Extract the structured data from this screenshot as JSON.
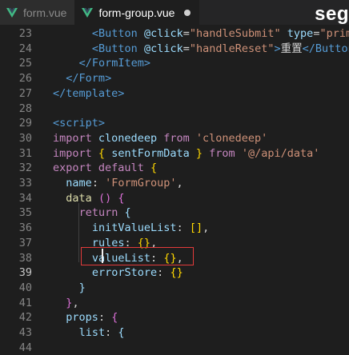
{
  "tabs": [
    {
      "label": "form.vue",
      "active": false,
      "modified": false
    },
    {
      "label": "form-group.vue",
      "active": true,
      "modified": true
    }
  ],
  "watermark": "seg",
  "editor": {
    "current_line": "39",
    "lines": [
      {
        "n": "23",
        "indent": 6,
        "tokens": [
          [
            "t-tag",
            "<Button"
          ],
          [
            "t-txt",
            " "
          ],
          [
            "t-attr",
            "@click"
          ],
          [
            "t-txt",
            "="
          ],
          [
            "t-str",
            "\"handleSubmit\""
          ],
          [
            "t-txt",
            " "
          ],
          [
            "t-attr",
            "type"
          ],
          [
            "t-txt",
            "="
          ],
          [
            "t-str",
            "\"primar"
          ]
        ]
      },
      {
        "n": "24",
        "indent": 6,
        "tokens": [
          [
            "t-tag",
            "<Button"
          ],
          [
            "t-txt",
            " "
          ],
          [
            "t-attr",
            "@click"
          ],
          [
            "t-txt",
            "="
          ],
          [
            "t-str",
            "\"handleReset\""
          ],
          [
            "t-tag",
            ">"
          ],
          [
            "t-txt",
            "重置"
          ],
          [
            "t-tag",
            "</Button"
          ],
          [
            "t-tag",
            ">"
          ]
        ]
      },
      {
        "n": "25",
        "indent": 4,
        "tokens": [
          [
            "t-tag",
            "</FormItem>"
          ]
        ]
      },
      {
        "n": "26",
        "indent": 2,
        "tokens": [
          [
            "t-tag",
            "</Form>"
          ]
        ]
      },
      {
        "n": "27",
        "indent": 0,
        "tokens": [
          [
            "t-tag",
            "</template>"
          ]
        ]
      },
      {
        "n": "28",
        "indent": 0,
        "tokens": []
      },
      {
        "n": "29",
        "indent": 0,
        "tokens": [
          [
            "t-tag",
            "<script>"
          ]
        ]
      },
      {
        "n": "30",
        "indent": 0,
        "tokens": [
          [
            "t-kw",
            "import"
          ],
          [
            "t-txt",
            " "
          ],
          [
            "t-attr",
            "clonedeep"
          ],
          [
            "t-txt",
            " "
          ],
          [
            "t-kw",
            "from"
          ],
          [
            "t-txt",
            " "
          ],
          [
            "t-str",
            "'clonedeep'"
          ]
        ]
      },
      {
        "n": "31",
        "indent": 0,
        "tokens": [
          [
            "t-kw",
            "import"
          ],
          [
            "t-txt",
            " "
          ],
          [
            "t-br",
            "{"
          ],
          [
            "t-txt",
            " "
          ],
          [
            "t-attr",
            "sentFormData"
          ],
          [
            "t-txt",
            " "
          ],
          [
            "t-br",
            "}"
          ],
          [
            "t-txt",
            " "
          ],
          [
            "t-kw",
            "from"
          ],
          [
            "t-txt",
            " "
          ],
          [
            "t-str",
            "'@/api/data'"
          ]
        ]
      },
      {
        "n": "32",
        "indent": 0,
        "tokens": [
          [
            "t-kw",
            "export"
          ],
          [
            "t-txt",
            " "
          ],
          [
            "t-kw",
            "default"
          ],
          [
            "t-txt",
            " "
          ],
          [
            "t-br",
            "{"
          ]
        ]
      },
      {
        "n": "33",
        "indent": 2,
        "tokens": [
          [
            "t-attr",
            "name"
          ],
          [
            "t-txt",
            ": "
          ],
          [
            "t-str",
            "'FormGroup'"
          ],
          [
            "t-txt",
            ","
          ]
        ]
      },
      {
        "n": "34",
        "indent": 2,
        "tokens": [
          [
            "t-fn",
            "data"
          ],
          [
            "t-txt",
            " "
          ],
          [
            "t-br2",
            "()"
          ],
          [
            "t-txt",
            " "
          ],
          [
            "t-br2",
            "{"
          ]
        ]
      },
      {
        "n": "35",
        "indent": 4,
        "tokens": [
          [
            "t-kw",
            "return"
          ],
          [
            "t-txt",
            " "
          ],
          [
            "t-attr",
            "{"
          ]
        ]
      },
      {
        "n": "36",
        "indent": 6,
        "tokens": [
          [
            "t-attr",
            "initValueList"
          ],
          [
            "t-txt",
            ": "
          ],
          [
            "t-br",
            "[]"
          ],
          [
            "t-txt",
            ","
          ]
        ]
      },
      {
        "n": "37",
        "indent": 6,
        "tokens": [
          [
            "t-attr",
            "rules"
          ],
          [
            "t-txt",
            ": "
          ],
          [
            "t-br",
            "{}"
          ],
          [
            "t-txt",
            ","
          ]
        ]
      },
      {
        "n": "38",
        "indent": 6,
        "tokens": [
          [
            "t-attr",
            "valueList"
          ],
          [
            "t-txt",
            ": "
          ],
          [
            "t-br",
            "{}"
          ],
          [
            "t-txt",
            ","
          ]
        ]
      },
      {
        "n": "39",
        "indent": 6,
        "tokens": [
          [
            "t-attr",
            "errorStore"
          ],
          [
            "t-txt",
            ": "
          ],
          [
            "t-br",
            "{}"
          ]
        ]
      },
      {
        "n": "40",
        "indent": 4,
        "tokens": [
          [
            "t-attr",
            "}"
          ]
        ]
      },
      {
        "n": "41",
        "indent": 2,
        "tokens": [
          [
            "t-br2",
            "}"
          ],
          [
            "t-txt",
            ","
          ]
        ]
      },
      {
        "n": "42",
        "indent": 2,
        "tokens": [
          [
            "t-attr",
            "props"
          ],
          [
            "t-txt",
            ": "
          ],
          [
            "t-br2",
            "{"
          ]
        ]
      },
      {
        "n": "43",
        "indent": 4,
        "tokens": [
          [
            "t-attr",
            "list"
          ],
          [
            "t-txt",
            ": "
          ],
          [
            "t-attr",
            "{"
          ]
        ]
      },
      {
        "n": "44",
        "indent": 6,
        "tokens": []
      }
    ]
  },
  "colors": {
    "background": "#1e1e1e",
    "tabbar": "#252526",
    "vue_green": "#41b883",
    "selection_box": "#e33b3b"
  },
  "icons": {
    "vue": "vue-logo-icon",
    "modified": "unsaved-dot-icon"
  }
}
